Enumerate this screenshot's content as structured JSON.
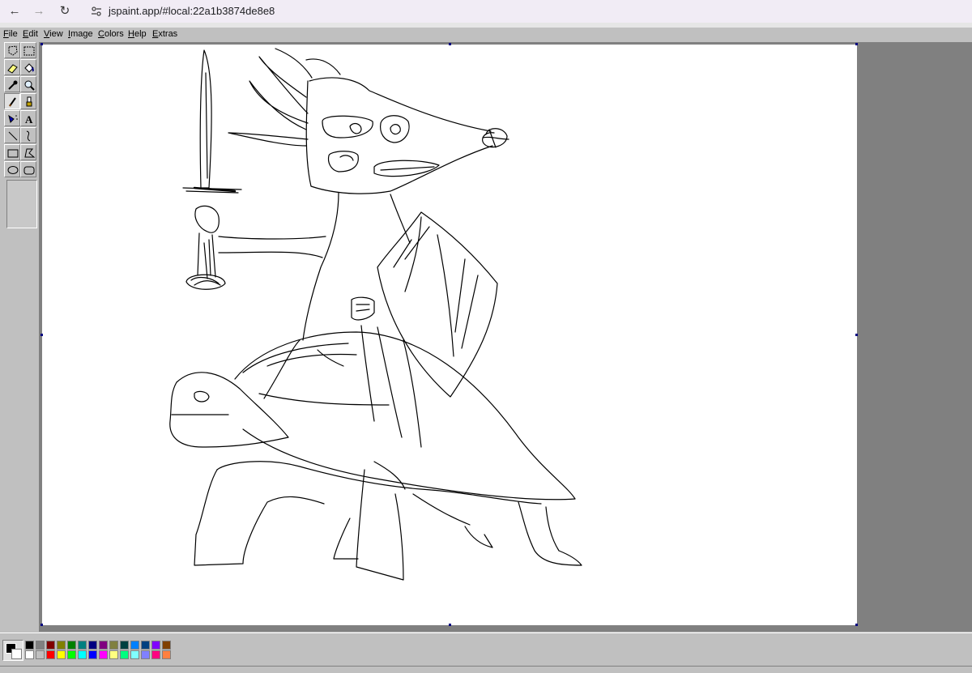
{
  "browser": {
    "back_icon": "arrow-left-icon",
    "forward_icon": "arrow-right-icon",
    "reload_icon": "reload-icon",
    "url": "jspaint.app/#local:22a1b3874de8e8"
  },
  "menu": [
    "File",
    "Edit",
    "View",
    "Image",
    "Colors",
    "Help",
    "Extras"
  ],
  "tools": [
    "free-form-select",
    "select",
    "eraser",
    "fill-with-color",
    "pick-color",
    "magnifier",
    "pencil",
    "brush",
    "airbrush",
    "text",
    "line",
    "curve",
    "rectangle",
    "polygon",
    "ellipse",
    "rounded-rectangle"
  ],
  "selected_tool": "pencil",
  "colors": {
    "foreground": "#000000",
    "background": "#ffffff",
    "palette_top": [
      "#000000",
      "#808080",
      "#800000",
      "#808000",
      "#008000",
      "#008080",
      "#000080",
      "#800080",
      "#808040",
      "#004040",
      "#0080ff",
      "#004080",
      "#8000ff",
      "#804000"
    ],
    "palette_bottom": [
      "#ffffff",
      "#c0c0c0",
      "#ff0000",
      "#ffff00",
      "#00ff00",
      "#00ffff",
      "#0000ff",
      "#ff00ff",
      "#ffff80",
      "#00ff80",
      "#80ffff",
      "#8080ff",
      "#ff0080",
      "#ff8040"
    ]
  }
}
